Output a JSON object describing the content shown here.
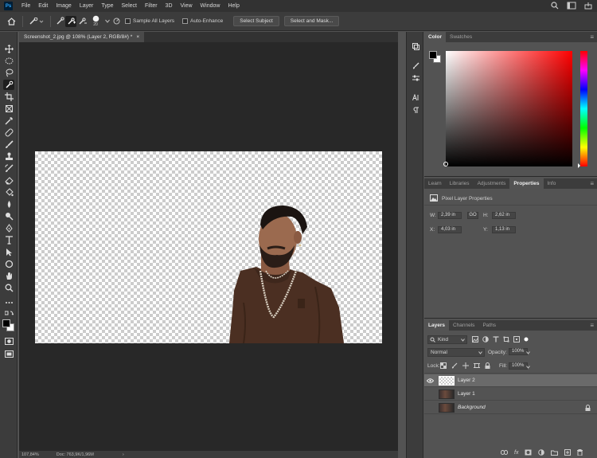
{
  "app": {
    "logo": "Ps"
  },
  "menubar": {
    "items": [
      "File",
      "Edit",
      "Image",
      "Layer",
      "Type",
      "Select",
      "Filter",
      "3D",
      "View",
      "Window",
      "Help"
    ],
    "right_icons": [
      "search-icon",
      "workspace-icon",
      "share-icon"
    ]
  },
  "options": {
    "brush_size": "20",
    "sample_all_layers": "Sample All Layers",
    "auto_enhance": "Auto-Enhance",
    "select_subject": "Select Subject",
    "select_and_mask": "Select and Mask..."
  },
  "tools": [
    "move-tool",
    "marquee-tool",
    "lasso-tool",
    "quick-selection-tool",
    "crop-tool",
    "frame-tool",
    "eyedropper-tool",
    "spot-healing-tool",
    "brush-tool",
    "clone-stamp-tool",
    "history-brush-tool",
    "eraser-tool",
    "paint-bucket-tool",
    "blur-tool",
    "dodge-tool",
    "pen-tool",
    "type-tool",
    "path-selection-tool",
    "ellipse-tool",
    "hand-tool",
    "zoom-tool",
    "edit-toolbar-icon"
  ],
  "document": {
    "tab_title": "Screenshot_2.jpg @ 108% (Layer 2, RGB/8#) *",
    "close": "×"
  },
  "status": {
    "zoom": "107,84%",
    "doc": "Doc: 763,9K/1,96M",
    "arrow": "›"
  },
  "color_panel": {
    "tabs": [
      "Color",
      "Swatches"
    ],
    "active": "Color",
    "foreground": "#000000",
    "background": "#ffffff",
    "hue": "#ff0000"
  },
  "properties_panel": {
    "tabs": [
      "Learn",
      "Libraries",
      "Adjustments",
      "Properties",
      "Info"
    ],
    "active": "Properties",
    "heading": "Pixel Layer Properties",
    "w_label": "W:",
    "w_value": "2,39 in",
    "link_label": "GO",
    "h_label": "H:",
    "h_value": "2,62 in",
    "x_label": "X:",
    "x_value": "4,03 in",
    "y_label": "Y:",
    "y_value": "1,13 in"
  },
  "layers_panel": {
    "tabs": [
      "Layers",
      "Channels",
      "Paths"
    ],
    "active": "Layers",
    "filter_kind": "Kind",
    "blend_mode": "Normal",
    "opacity_label": "Opacity:",
    "opacity_value": "100%",
    "lock_label": "Lock:",
    "fill_label": "Fill:",
    "fill_value": "100%",
    "layers": [
      {
        "name": "Layer 2",
        "visible": true,
        "selected": true
      },
      {
        "name": "Layer 1",
        "visible": false,
        "selected": false
      },
      {
        "name": "Background",
        "visible": false,
        "selected": false,
        "locked": true
      }
    ]
  }
}
